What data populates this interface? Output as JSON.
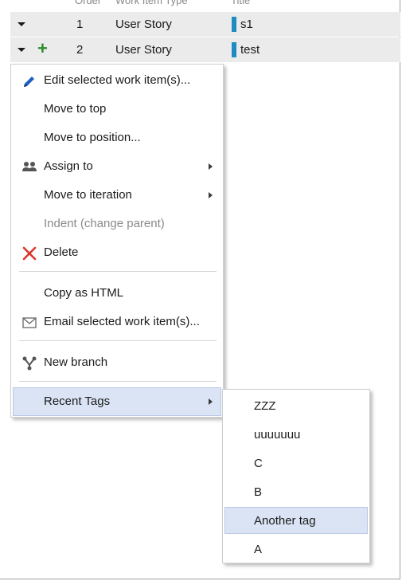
{
  "grid": {
    "headers": {
      "order": "Order",
      "type": "Work Item Type",
      "title": "Title"
    },
    "rows": [
      {
        "order": "1",
        "type": "User Story",
        "title": "s1",
        "color": "#1e8bc3",
        "has_add": false
      },
      {
        "order": "2",
        "type": "User Story",
        "title": "test",
        "color": "#1e8bc3",
        "has_add": true
      }
    ]
  },
  "menu": {
    "items": [
      {
        "label": "Edit selected work item(s)...",
        "icon": "pencil-icon"
      },
      {
        "label": "Move to top"
      },
      {
        "label": "Move to position..."
      },
      {
        "label": "Assign to",
        "icon": "people-icon",
        "submenu": true
      },
      {
        "label": "Move to iteration",
        "submenu": true
      },
      {
        "label": "Indent (change parent)",
        "disabled": true
      },
      {
        "label": "Delete",
        "icon": "delete-x-icon"
      },
      {
        "label": "Copy as HTML"
      },
      {
        "label": "Email selected work item(s)...",
        "icon": "envelope-icon"
      },
      {
        "label": "New branch",
        "icon": "branch-icon"
      },
      {
        "label": "Recent Tags",
        "submenu": true,
        "highlighted": true
      }
    ]
  },
  "recent_tags": {
    "items": [
      "ZZZ",
      "uuuuuuu",
      "C",
      "B",
      "Another tag",
      "A"
    ],
    "highlighted": "Another tag"
  },
  "colors": {
    "row_background": "#ebebeb",
    "highlight": "#dbe4f5",
    "delete_icon": "#d9342b",
    "pencil_icon": "#1f5fbf",
    "add_icon": "#2e8b2e"
  }
}
